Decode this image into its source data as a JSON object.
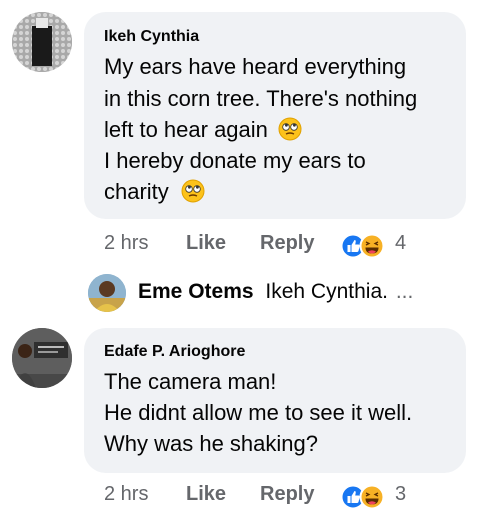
{
  "comments": [
    {
      "author": "Ikeh Cynthia",
      "lines": [
        "My ears have heard everything",
        "in this corn tree. There's nothing",
        "left to hear again",
        "I hereby donate my ears to",
        "charity"
      ],
      "time": "2 hrs",
      "like_label": "Like",
      "reply_label": "Reply",
      "reaction_count": "4",
      "reactions": [
        "like-icon",
        "haha-icon"
      ]
    },
    {
      "author": "Edafe P. Arioghore",
      "lines": [
        "The camera man!",
        "He didnt allow me to see it well.",
        "Why was he shaking?"
      ],
      "time": "2 hrs",
      "like_label": "Like",
      "reply_label": "Reply",
      "reaction_count": "3",
      "reactions": [
        "like-icon",
        "haha-icon"
      ]
    }
  ],
  "reply_preview": {
    "author": "Eme Otems",
    "text": "Ikeh Cynthia.",
    "more": "..."
  },
  "colors": {
    "bubble": "#f0f2f5",
    "meta_text": "#65676b",
    "like_blue": "#1877f2",
    "haha_yellow": "#f7b125"
  }
}
